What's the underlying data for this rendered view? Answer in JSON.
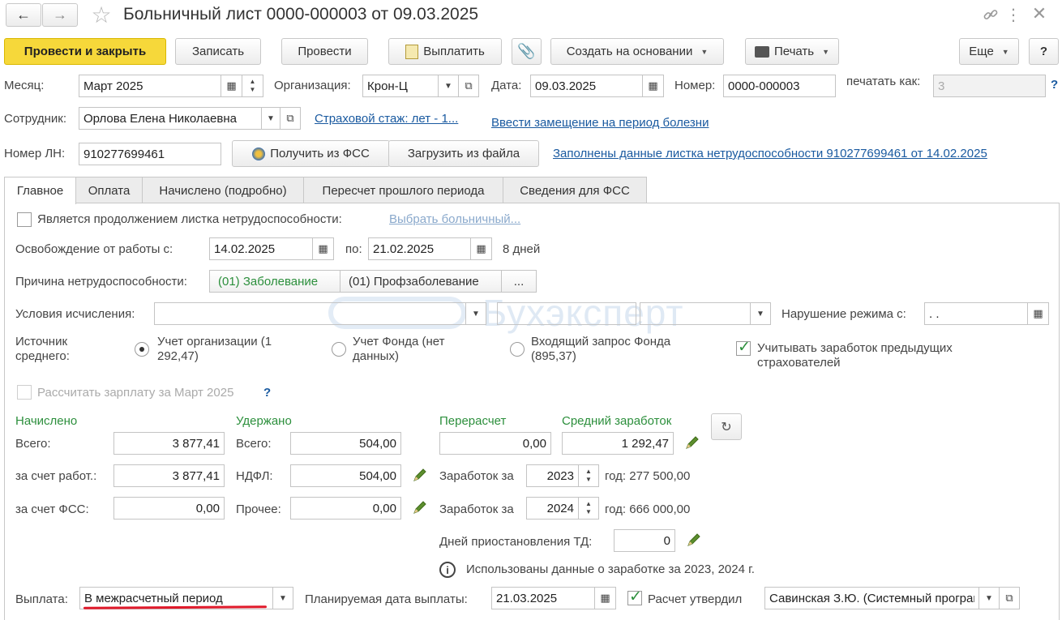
{
  "window": {
    "title": "Больничный лист 0000-000003 от 09.03.2025"
  },
  "toolbar": {
    "post_close": "Провести и закрыть",
    "write": "Записать",
    "post": "Провести",
    "pay": "Выплатить",
    "create_based": "Создать на основании",
    "print": "Печать",
    "more": "Еще",
    "help": "?"
  },
  "header": {
    "month_label": "Месяц:",
    "month_value": "Март 2025",
    "org_label": "Организация:",
    "org_value": "Крон-Ц",
    "date_label": "Дата:",
    "date_value": "09.03.2025",
    "number_label": "Номер:",
    "number_value": "0000-000003",
    "print_as_label": "печатать как:",
    "print_as_value": "3",
    "help_mark": "?",
    "employee_label": "Сотрудник:",
    "employee_value": "Орлова Елена Николаевна",
    "insurance_link": "Страховой стаж: лет - 1...",
    "substitution_link": "Ввести замещение на период болезни",
    "ln_label": "Номер ЛН:",
    "ln_value": "910277699461",
    "get_fss": "Получить из ФСС",
    "load_file": "Загрузить из файла",
    "filled_link": "Заполнены данные листка нетрудоспособности 910277699461 от 14.02.2025"
  },
  "tabs": [
    {
      "label": "Главное",
      "active": true
    },
    {
      "label": "Оплата",
      "active": false
    },
    {
      "label": "Начислено (подробно)",
      "active": false
    },
    {
      "label": "Пересчет прошлого периода",
      "active": false
    },
    {
      "label": "Сведения для ФСС",
      "active": false
    }
  ],
  "main": {
    "continuation_label": "Является продолжением листка нетрудоспособности:",
    "continuation_link": "Выбрать больничный...",
    "release_label": "Освобождение от работы с:",
    "release_from": "14.02.2025",
    "release_to_label": "по:",
    "release_to": "21.02.2025",
    "days": "8 дней",
    "reason_label": "Причина нетрудоспособности:",
    "reason_1": "(01) Заболевание",
    "reason_2": "(01) Профзаболевание",
    "reason_more": "...",
    "conditions_label": "Условия исчисления:",
    "violation_label": "Нарушение режима с:",
    "violation_value": " .  .",
    "source_label": "Источник среднего:",
    "source_org": "Учет организации (1 292,47)",
    "source_fund": "Учет Фонда (нет данных)",
    "source_request": "Входящий запрос Фонда (895,37)",
    "prev_insurers": "Учитывать заработок предыдущих страхователей",
    "calc_salary": "Рассчитать зарплату за Март 2025",
    "calc_help": "?",
    "accrued_title": "Начислено",
    "withheld_title": "Удержано",
    "recalc_title": "Перерасчет",
    "avg_title": "Средний заработок",
    "total_label": "Всего:",
    "accrued_total": "3 877,41",
    "employer_label": "за счет работ.:",
    "accrued_employer": "3 877,41",
    "fss_label": "за счет ФСС:",
    "accrued_fss": "0,00",
    "withheld_total_label": "Всего:",
    "withheld_total": "504,00",
    "ndfl_label": "НДФЛ:",
    "withheld_ndfl": "504,00",
    "other_label": "Прочее:",
    "withheld_other": "0,00",
    "recalc_value": "0,00",
    "avg_value": "1 292,47",
    "earnings_label_1": "Заработок за",
    "earnings_year_1": "2023",
    "earnings_amount_1": "год: 277 500,00",
    "earnings_label_2": "Заработок за",
    "earnings_year_2": "2024",
    "earnings_amount_2": "год: 666 000,00",
    "suspension_label": "Дней приостановления ТД:",
    "suspension_value": "0",
    "info_text": "Использованы данные о заработке за  2023,  2024 г.",
    "payout_label": "Выплата:",
    "payout_value": "В межрасчетный период",
    "planned_label": "Планируемая дата выплаты:",
    "planned_value": "21.03.2025",
    "approved_label": "Расчет утвердил",
    "approved_value": "Савинская З.Ю. (Системный программист)"
  },
  "watermark": "Бухэксперт",
  "colors": {
    "primary_button": "#f6d83a",
    "green_heading": "#2c8f3c",
    "link": "#1a5aa0",
    "underline": "#e0192a"
  }
}
